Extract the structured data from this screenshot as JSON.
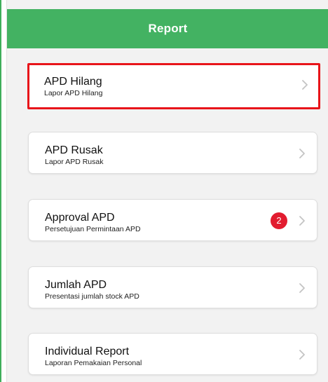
{
  "header": {
    "title": "Report"
  },
  "menu": [
    {
      "title": "APD Hilang",
      "subtitle": "Lapor APD Hilang"
    },
    {
      "title": "APD Rusak",
      "subtitle": "Lapor APD Rusak"
    },
    {
      "title": "Approval APD",
      "subtitle": "Persetujuan Permintaan APD",
      "badge": "2"
    },
    {
      "title": "Jumlah APD",
      "subtitle": "Presentasi jumlah stock APD"
    },
    {
      "title": "Individual Report",
      "subtitle": "Laporan Pemakaian Personal"
    }
  ],
  "colors": {
    "header_bg": "#43b262",
    "highlight_border": "#e8141a",
    "badge_bg": "#e21c2f",
    "page_bg": "#f2f2f2"
  },
  "icons": {
    "row_chevron": "chevron-right-icon"
  }
}
